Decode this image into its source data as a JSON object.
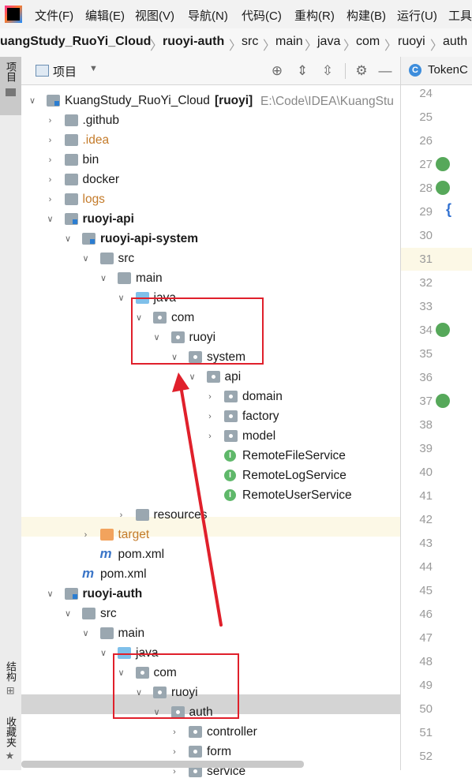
{
  "menu": [
    "文件(F)",
    "编辑(E)",
    "视图(V)",
    "导航(N)",
    "代码(C)",
    "重构(R)",
    "构建(B)",
    "运行(U)",
    "工具"
  ],
  "breadcrumbs": [
    "uangStudy_RuoYi_Cloud",
    "ruoyi-auth",
    "src",
    "main",
    "java",
    "com",
    "ruoyi",
    "auth"
  ],
  "left_strip": {
    "project": "项目",
    "structure": "结构",
    "favorites": "收藏夹"
  },
  "panel": {
    "title": "项目"
  },
  "tree": [
    {
      "label": "KuangStudy_RuoYi_Cloud",
      "tag": "[ruoyi]",
      "path": "E:\\Code\\IDEA\\KuangStu"
    },
    {
      "label": ".github"
    },
    {
      "label": ".idea"
    },
    {
      "label": "bin"
    },
    {
      "label": "docker"
    },
    {
      "label": "logs"
    },
    {
      "label": "ruoyi-api"
    },
    {
      "label": "ruoyi-api-system"
    },
    {
      "label": "src"
    },
    {
      "label": "main"
    },
    {
      "label": "java"
    },
    {
      "label": "com"
    },
    {
      "label": "ruoyi"
    },
    {
      "label": "system"
    },
    {
      "label": "api"
    },
    {
      "label": "domain"
    },
    {
      "label": "factory"
    },
    {
      "label": "model"
    },
    {
      "label": "RemoteFileService"
    },
    {
      "label": "RemoteLogService"
    },
    {
      "label": "RemoteUserService"
    },
    {
      "label": "resources"
    },
    {
      "label": "target"
    },
    {
      "label": "pom.xml"
    },
    {
      "label": "pom.xml"
    },
    {
      "label": "ruoyi-auth"
    },
    {
      "label": "src"
    },
    {
      "label": "main"
    },
    {
      "label": "java"
    },
    {
      "label": "com"
    },
    {
      "label": "ruoyi"
    },
    {
      "label": "auth"
    },
    {
      "label": "controller"
    },
    {
      "label": "form"
    },
    {
      "label": "service"
    }
  ],
  "editor": {
    "tab": "TokenC",
    "tab_icon": "C",
    "line_numbers": [
      "24",
      "25",
      "26",
      "27",
      "28",
      "29",
      "30",
      "31",
      "32",
      "33",
      "34",
      "35",
      "36",
      "37",
      "38",
      "39",
      "40",
      "41",
      "42",
      "43",
      "44",
      "45",
      "46",
      "47",
      "48",
      "49",
      "50",
      "51",
      "52"
    ],
    "brace": "{"
  },
  "colors": {
    "highlight_box": "#e0202b",
    "arrow": "#e0202b",
    "active_row": "#d4d4d4",
    "target_row": "#fcf8e6"
  }
}
